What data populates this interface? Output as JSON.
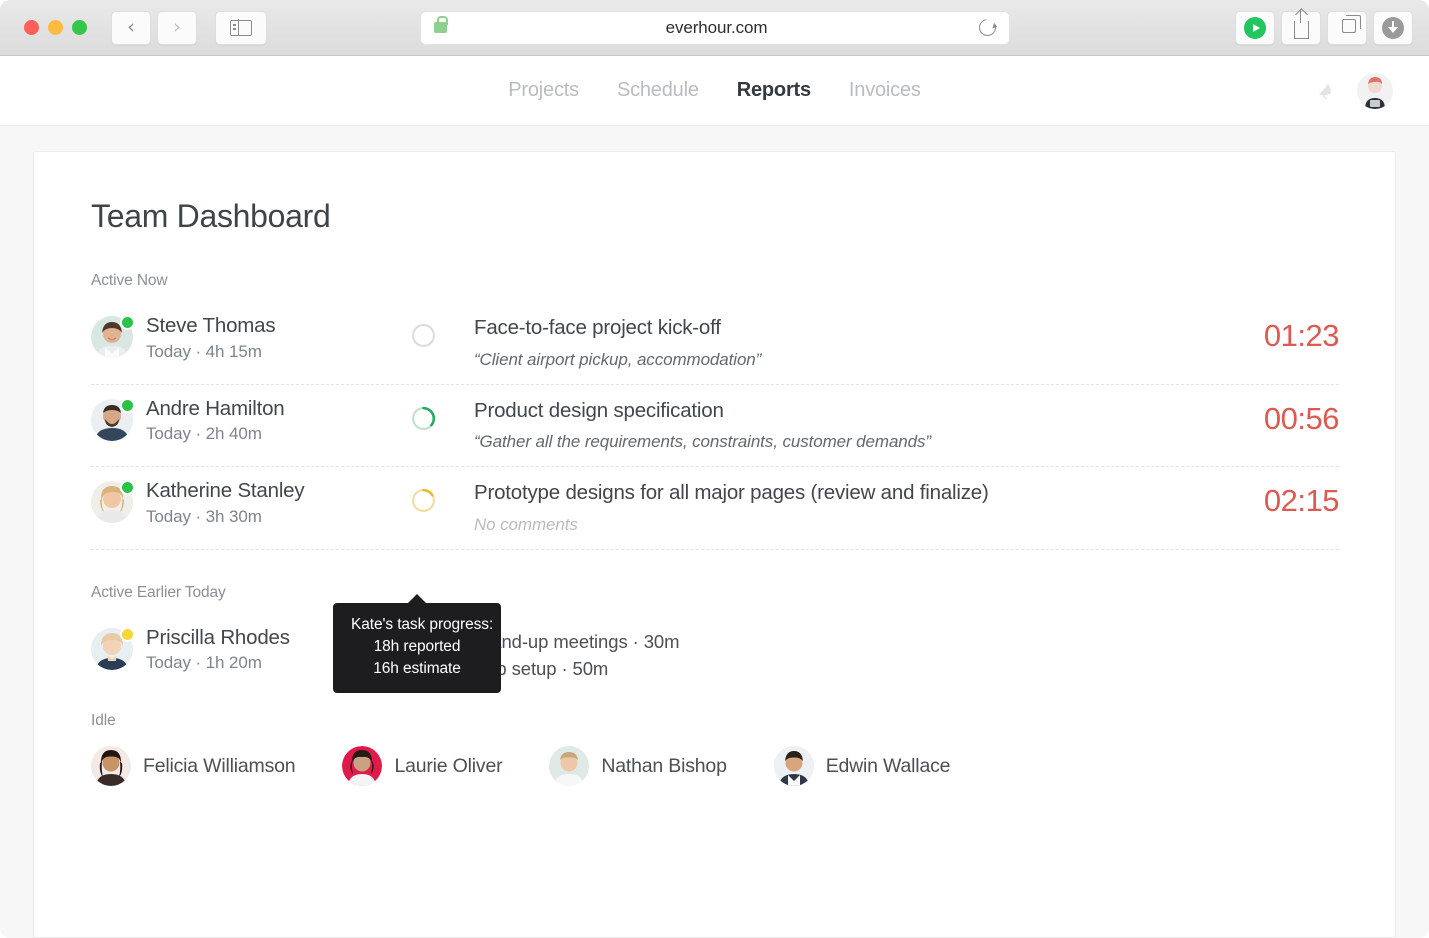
{
  "browser": {
    "url": "everhour.com",
    "lock_icon": "lock-icon",
    "reload_icon": "reload-icon",
    "back_icon": "chevron-left-icon",
    "forward_icon": "chevron-right-icon",
    "sidebar_icon": "sidebar-toggle-icon",
    "play_icon": "play-extension-icon",
    "share_icon": "share-icon",
    "tabs_icon": "tab-overview-icon",
    "download_icon": "download-icon"
  },
  "header": {
    "nav": [
      {
        "label": "Projects",
        "active": false
      },
      {
        "label": "Schedule",
        "active": false
      },
      {
        "label": "Reports",
        "active": true
      },
      {
        "label": "Invoices",
        "active": false
      }
    ],
    "bell_icon": "notification-bell-icon",
    "avatar": "user-avatar"
  },
  "main": {
    "title": "Team Dashboard",
    "sections": {
      "active_now": "Active Now",
      "active_earlier": "Active Earlier Today",
      "idle": "Idle"
    },
    "active_now": [
      {
        "name": "Steve Thomas",
        "meta": "Today ·  4h 15m",
        "status": "online",
        "progress": "empty",
        "task": "Face-to-face project kick-off",
        "note": "“Client airport pickup, accommodation”",
        "note_muted": false,
        "timer": "01:23"
      },
      {
        "name": "Andre Hamilton",
        "meta": "Today ·  2h 40m",
        "status": "online",
        "progress": "green",
        "task": "Product design specification",
        "note": "“Gather all the requirements, constraints, customer demands”",
        "note_muted": false,
        "timer": "00:56"
      },
      {
        "name": "Katherine Stanley",
        "meta": "Today ·  3h 30m",
        "status": "online",
        "progress": "yellow",
        "task": "Prototype designs for all major pages (review and finalize)",
        "note": "No comments",
        "note_muted": true,
        "timer": "02:15"
      }
    ],
    "active_earlier": [
      {
        "name": "Priscilla Rhodes",
        "meta": "Today ·  1h 20m",
        "status": "away",
        "tasks": [
          "Stand-up meetings ·  30m",
          "App setup ·  50m"
        ]
      }
    ],
    "idle": [
      {
        "name": "Felicia Williamson"
      },
      {
        "name": "Laurie Oliver"
      },
      {
        "name": "Nathan Bishop"
      },
      {
        "name": "Edwin Wallace"
      }
    ]
  },
  "tooltip": {
    "line1": "Kate's task progress:",
    "line2": "18h reported",
    "line3": "16h estimate"
  },
  "colors": {
    "timer_red": "#dd5a52",
    "status_online": "#2bc24a",
    "status_away": "#f5d63d",
    "progress_green": "#2aa85f",
    "progress_yellow": "#e9b92c",
    "nav_active": "#333a40",
    "nav_inactive": "#b9bcc0"
  }
}
